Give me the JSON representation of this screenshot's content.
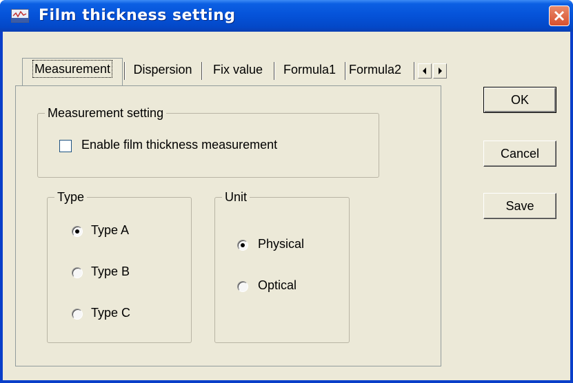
{
  "window": {
    "title": "Film thickness setting",
    "icon": "chart-app-icon"
  },
  "tabs": [
    {
      "label": "Measurement",
      "selected": true
    },
    {
      "label": "Dispersion",
      "selected": false
    },
    {
      "label": "Fix value",
      "selected": false
    },
    {
      "label": "Formula1",
      "selected": false
    },
    {
      "label": "Formula2",
      "selected": false
    }
  ],
  "tab_scroll": {
    "left": "◄",
    "right": "►"
  },
  "measurement_setting": {
    "label": "Measurement setting",
    "enable_checkbox": {
      "label": "Enable film thickness measurement",
      "checked": false
    }
  },
  "type_group": {
    "label": "Type",
    "options": [
      {
        "label": "Type A",
        "selected": true
      },
      {
        "label": "Type B",
        "selected": false
      },
      {
        "label": "Type C",
        "selected": false
      }
    ]
  },
  "unit_group": {
    "label": "Unit",
    "options": [
      {
        "label": "Physical",
        "selected": true
      },
      {
        "label": "Optical",
        "selected": false
      }
    ]
  },
  "buttons": {
    "ok": "OK",
    "cancel": "Cancel",
    "save": "Save"
  },
  "colors": {
    "titlebar": "#0552d8",
    "face": "#ece9d8",
    "close": "#d8502e"
  }
}
